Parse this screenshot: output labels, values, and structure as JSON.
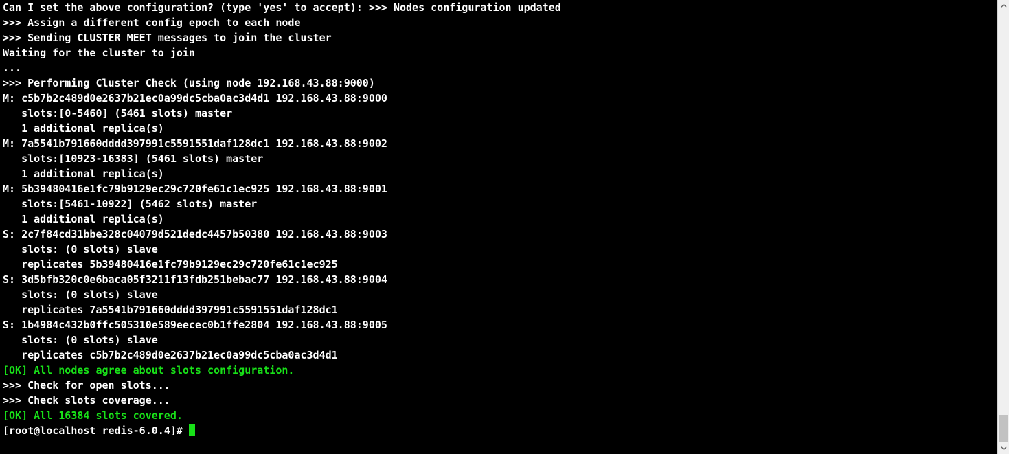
{
  "lines": [
    {
      "segs": [
        {
          "t": "Can I set the above configuration? (type 'yes' to accept): ",
          "c": "white"
        },
        {
          "t": ">>> Nodes configuration updated",
          "c": "white"
        }
      ]
    },
    {
      "segs": [
        {
          "t": ">>> Assign a different config epoch to each node",
          "c": "white"
        }
      ]
    },
    {
      "segs": [
        {
          "t": ">>> Sending CLUSTER MEET messages to join the cluster",
          "c": "white"
        }
      ]
    },
    {
      "segs": [
        {
          "t": "Waiting for the cluster to join",
          "c": "white"
        }
      ]
    },
    {
      "segs": [
        {
          "t": "...",
          "c": "white"
        }
      ]
    },
    {
      "segs": [
        {
          "t": ">>> Performing Cluster Check (using node 192.168.43.88:9000)",
          "c": "white"
        }
      ]
    },
    {
      "segs": [
        {
          "t": "M: c5b7b2c489d0e2637b21ec0a99dc5cba0ac3d4d1 192.168.43.88:9000",
          "c": "white"
        }
      ]
    },
    {
      "segs": [
        {
          "t": "   slots:[0-5460] (5461 slots) master",
          "c": "white"
        }
      ]
    },
    {
      "segs": [
        {
          "t": "   1 additional replica(s)",
          "c": "white"
        }
      ]
    },
    {
      "segs": [
        {
          "t": "M: 7a5541b791660dddd397991c5591551daf128dc1 192.168.43.88:9002",
          "c": "white"
        }
      ]
    },
    {
      "segs": [
        {
          "t": "   slots:[10923-16383] (5461 slots) master",
          "c": "white"
        }
      ]
    },
    {
      "segs": [
        {
          "t": "   1 additional replica(s)",
          "c": "white"
        }
      ]
    },
    {
      "segs": [
        {
          "t": "M: 5b39480416e1fc79b9129ec29c720fe61c1ec925 192.168.43.88:9001",
          "c": "white"
        }
      ]
    },
    {
      "segs": [
        {
          "t": "   slots:[5461-10922] (5462 slots) master",
          "c": "white"
        }
      ]
    },
    {
      "segs": [
        {
          "t": "   1 additional replica(s)",
          "c": "white"
        }
      ]
    },
    {
      "segs": [
        {
          "t": "S: 2c7f84cd31bbe328c04079d521dedc4457b50380 192.168.43.88:9003",
          "c": "white"
        }
      ]
    },
    {
      "segs": [
        {
          "t": "   slots: (0 slots) slave",
          "c": "white"
        }
      ]
    },
    {
      "segs": [
        {
          "t": "   replicates 5b39480416e1fc79b9129ec29c720fe61c1ec925",
          "c": "white"
        }
      ]
    },
    {
      "segs": [
        {
          "t": "S: 3d5bfb320c0e6baca05f3211f13fdb251bebac77 192.168.43.88:9004",
          "c": "white"
        }
      ]
    },
    {
      "segs": [
        {
          "t": "   slots: (0 slots) slave",
          "c": "white"
        }
      ]
    },
    {
      "segs": [
        {
          "t": "   replicates 7a5541b791660dddd397991c5591551daf128dc1",
          "c": "white"
        }
      ]
    },
    {
      "segs": [
        {
          "t": "S: 1b4984c432b0ffc505310e589eecec0b1ffe2804 192.168.43.88:9005",
          "c": "white"
        }
      ]
    },
    {
      "segs": [
        {
          "t": "   slots: (0 slots) slave",
          "c": "white"
        }
      ]
    },
    {
      "segs": [
        {
          "t": "   replicates c5b7b2c489d0e2637b21ec0a99dc5cba0ac3d4d1",
          "c": "white"
        }
      ]
    },
    {
      "segs": [
        {
          "t": "[OK] All nodes agree about slots configuration.",
          "c": "green"
        }
      ]
    },
    {
      "segs": [
        {
          "t": ">>> Check for open slots...",
          "c": "white"
        }
      ]
    },
    {
      "segs": [
        {
          "t": ">>> Check slots coverage...",
          "c": "white"
        }
      ]
    },
    {
      "segs": [
        {
          "t": "[OK] All 16384 slots covered.",
          "c": "green"
        }
      ]
    }
  ],
  "prompt": "[root@localhost redis-6.0.4]# "
}
